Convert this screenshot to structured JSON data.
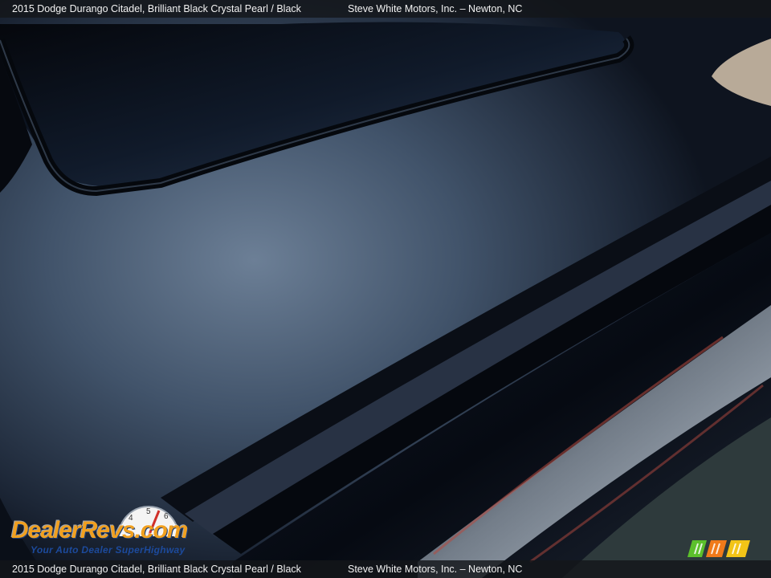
{
  "caption": {
    "title": "2015 Dodge Durango Citadel,  Brilliant Black Crystal Pearl / Black",
    "dealer": "Steve White Motors, Inc. – Newton, NC"
  },
  "watermark": {
    "brand": "DealerRevs.com",
    "tagline": "Your Auto Dealer SuperHighway",
    "gauge_numbers": [
      "4",
      "5",
      "6"
    ]
  },
  "colors": {
    "paint": "#1b2536",
    "trim": "#070a10",
    "brand_orange": "#f0a020",
    "brand_blue": "#1c4a9c"
  },
  "icons": {
    "corner_logo": "mm-stripes-logo"
  }
}
